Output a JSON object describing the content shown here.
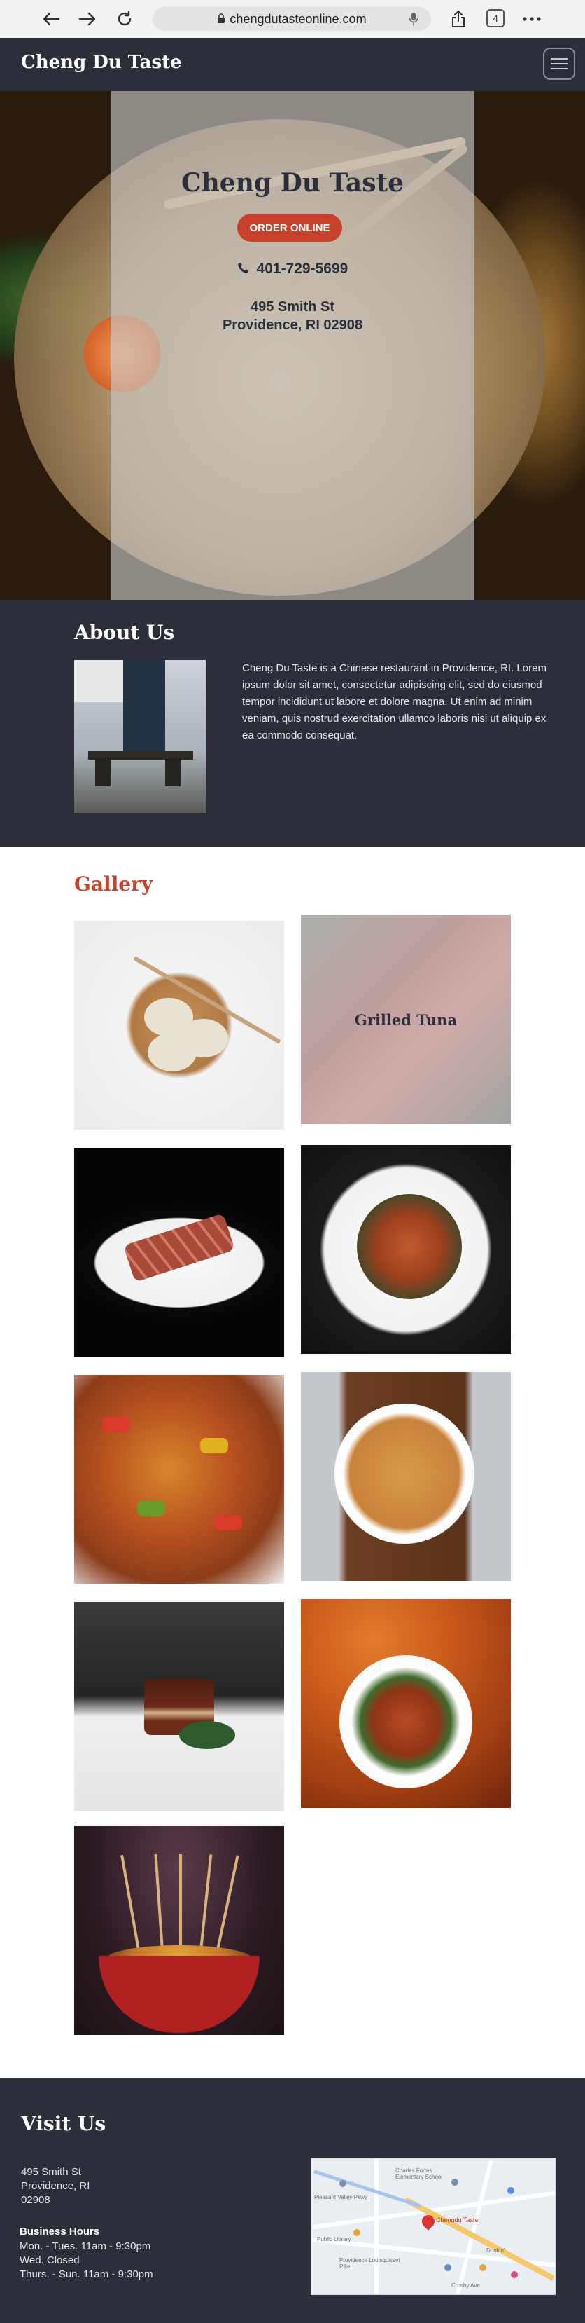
{
  "browser": {
    "url": "chengdutasteonline.com",
    "tab_count": "4"
  },
  "header": {
    "logo": "Cheng Du Taste"
  },
  "hero": {
    "title": "Cheng Du Taste",
    "order_button": "ORDER ONLINE",
    "phone": "401-729-5699",
    "address_line1": "495 Smith St",
    "address_line2": "Providence, RI 02908"
  },
  "about": {
    "title": "About Us",
    "text": "Cheng Du Taste is a Chinese restaurant in Providence, RI. Lorem ipsum dolor sit amet, consectetur adipiscing elit, sed do eiusmod tempor incididunt ut labore et dolore magna. Ut enim ad minim veniam, quis nostrud exercitation ullamco laboris nisi ut aliquip ex ea commodo consequat."
  },
  "gallery": {
    "title": "Gallery",
    "hover_label": "Grilled Tuna"
  },
  "visit": {
    "title": "Visit Us",
    "address": [
      "495 Smith St",
      "Providence, RI",
      "02908"
    ],
    "hours_title": "Business Hours",
    "hours": [
      "Mon. - Tues. 11am - 9:30pm",
      "Wed.  Closed",
      "Thurs. - Sun.  11am - 9:30pm"
    ],
    "map": {
      "pin_label": "Chengdu Taste",
      "labels": [
        "Charles Fortes Elementary School",
        "Pleasant Valley Pkwy",
        "Dunkin'",
        "Crosby Ave",
        "Public Library",
        "Providence Louisquisset Pike"
      ]
    }
  },
  "colors": {
    "dark": "#2c2f3a",
    "accent": "#c8422b",
    "overlay": "#cdcdcd"
  }
}
